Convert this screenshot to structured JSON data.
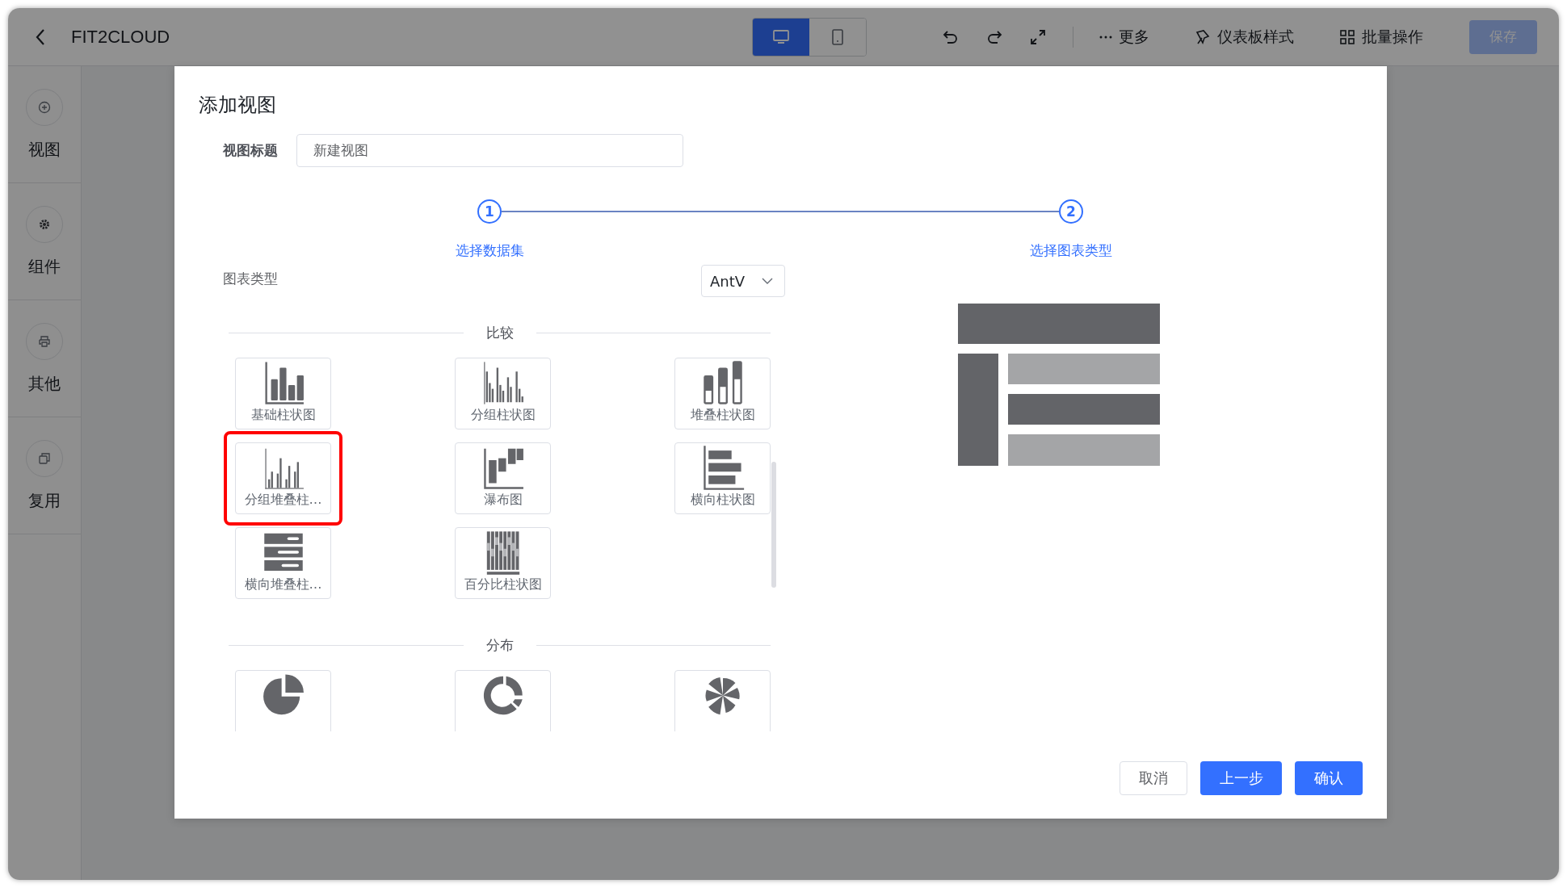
{
  "topbar": {
    "title": "FIT2CLOUD",
    "devices": [
      {
        "kind": "desktop",
        "selected": true
      },
      {
        "kind": "mobile",
        "selected": false
      }
    ],
    "actions": [
      {
        "kind": "more",
        "label": "更多"
      },
      {
        "kind": "style",
        "label": "仪表板样式"
      },
      {
        "kind": "batch",
        "label": "批量操作"
      }
    ],
    "save": {
      "label": "保存",
      "disabled": true
    }
  },
  "sidebar": [
    {
      "kind": "add",
      "label": "视图"
    },
    {
      "kind": "gear",
      "label": "组件"
    },
    {
      "kind": "other",
      "label": "其他"
    },
    {
      "kind": "copy",
      "label": "复用"
    }
  ],
  "dialog": {
    "title": "添加视图",
    "field_label": "视图标题",
    "field_value": "新建视图",
    "steps": [
      {
        "number": "1",
        "label": "选择数据集"
      },
      {
        "number": "2",
        "label": "选择图表类型"
      }
    ],
    "chart_type_label": "图表类型",
    "library": "AntV",
    "sections": [
      {
        "title": "比较",
        "items": [
          {
            "kind": "bar",
            "label": "基础柱状图",
            "highlighted": false
          },
          {
            "kind": "grouped-bar",
            "label": "分组柱状图",
            "highlighted": false
          },
          {
            "kind": "stacked-bar",
            "label": "堆叠柱状图",
            "highlighted": false
          },
          {
            "kind": "grouped-stacked",
            "label": "分组堆叠柱…",
            "highlighted": true
          },
          {
            "kind": "waterfall",
            "label": "瀑布图",
            "highlighted": false
          },
          {
            "kind": "horizontal-bar",
            "label": "横向柱状图",
            "highlighted": false
          },
          {
            "kind": "horizontal-stacked",
            "label": "横向堆叠柱…",
            "highlighted": false
          },
          {
            "kind": "percent-bar",
            "label": "百分比柱状图",
            "highlighted": false
          }
        ]
      },
      {
        "title": "分布",
        "items": [
          {
            "kind": "pie",
            "highlighted": false
          },
          {
            "kind": "donut",
            "highlighted": false
          },
          {
            "kind": "rose",
            "highlighted": false
          }
        ]
      }
    ],
    "buttons": [
      {
        "kind": "plain",
        "label": "取消"
      },
      {
        "kind": "primary",
        "label": "上一步"
      },
      {
        "kind": "primary",
        "label": "确认"
      }
    ]
  }
}
